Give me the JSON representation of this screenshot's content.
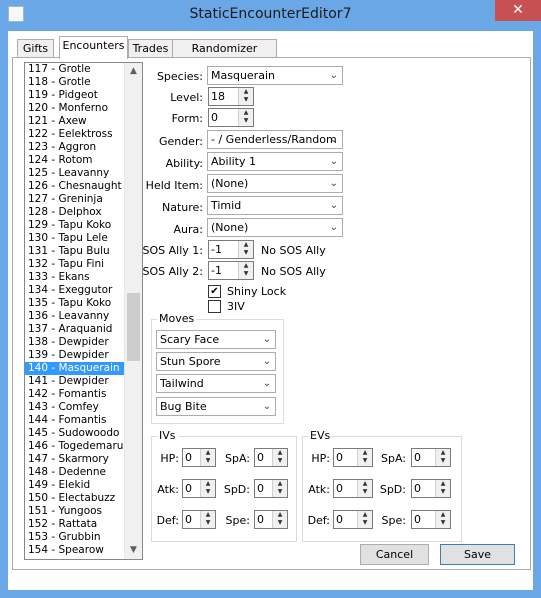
{
  "window": {
    "title": "StaticEncounterEditor7",
    "close_label": "✕"
  },
  "tabs": [
    {
      "label": "Gifts"
    },
    {
      "label": "Encounters"
    },
    {
      "label": "Trades"
    },
    {
      "label": "Randomizer Options"
    }
  ],
  "encounter_list": {
    "items": [
      "117 - Grotle",
      "118 - Grotle",
      "119 - Pidgeot",
      "120 - Monferno",
      "121 - Axew",
      "122 - Eelektross",
      "123 - Aggron",
      "124 - Rotom",
      "125 - Leavanny",
      "126 - Chesnaught",
      "127 - Greninja",
      "128 - Delphox",
      "129 - Tapu Koko",
      "130 - Tapu Lele",
      "131 - Tapu Bulu",
      "132 - Tapu Fini",
      "133 - Ekans",
      "134 - Exeggutor",
      "135 - Tapu Koko",
      "136 - Leavanny",
      "137 - Araquanid",
      "138 - Dewpider",
      "139 - Dewpider",
      "140 - Masquerain",
      "141 - Dewpider",
      "142 - Fomantis",
      "143 - Comfey",
      "144 - Fomantis",
      "145 - Sudowoodo",
      "146 - Togedemaru",
      "147 - Skarmory",
      "148 - Dedenne",
      "149 - Elekid",
      "150 - Electabuzz",
      "151 - Yungoos",
      "152 - Rattata",
      "153 - Grubbin",
      "154 - Spearow"
    ],
    "selected": "140 - Masquerain"
  },
  "form": {
    "species": {
      "label": "Species:",
      "value": "Masquerain"
    },
    "level": {
      "label": "Level:",
      "value": "18"
    },
    "form": {
      "label": "Form:",
      "value": "0"
    },
    "gender": {
      "label": "Gender:",
      "value": "- / Genderless/Random"
    },
    "ability": {
      "label": "Ability:",
      "value": "Ability 1"
    },
    "held_item": {
      "label": "Held Item:",
      "value": "(None)"
    },
    "nature": {
      "label": "Nature:",
      "value": "Timid"
    },
    "aura": {
      "label": "Aura:",
      "value": "(None)"
    },
    "sos1": {
      "label": "SOS Ally 1:",
      "value": "-1",
      "status": "No SOS Ally"
    },
    "sos2": {
      "label": "SOS Ally 2:",
      "value": "-1",
      "status": "No SOS Ally"
    },
    "shiny_lock": {
      "label": "Shiny Lock",
      "checked": true,
      "mark": "✔"
    },
    "three_iv": {
      "label": "3IV",
      "checked": false,
      "mark": ""
    }
  },
  "moves": {
    "title": "Moves",
    "items": [
      "Scary Face",
      "Stun Spore",
      "Tailwind",
      "Bug Bite"
    ]
  },
  "ivs": {
    "title": "IVs",
    "hp": {
      "label": "HP:",
      "value": "0"
    },
    "atk": {
      "label": "Atk:",
      "value": "0"
    },
    "def": {
      "label": "Def:",
      "value": "0"
    },
    "spa": {
      "label": "SpA:",
      "value": "0"
    },
    "spd": {
      "label": "SpD:",
      "value": "0"
    },
    "spe": {
      "label": "Spe:",
      "value": "0"
    }
  },
  "evs": {
    "title": "EVs",
    "hp": {
      "label": "HP:",
      "value": "0"
    },
    "atk": {
      "label": "Atk:",
      "value": "0"
    },
    "def": {
      "label": "Def:",
      "value": "0"
    },
    "spa": {
      "label": "SpA:",
      "value": "0"
    },
    "spd": {
      "label": "SpD:",
      "value": "0"
    },
    "spe": {
      "label": "Spe:",
      "value": "0"
    }
  },
  "buttons": {
    "cancel": "Cancel",
    "save": "Save"
  },
  "icons": {
    "dropdown": "chevron-down-icon",
    "spin_up": "spin-up-icon",
    "spin_down": "spin-down-icon",
    "check": "check-icon"
  }
}
